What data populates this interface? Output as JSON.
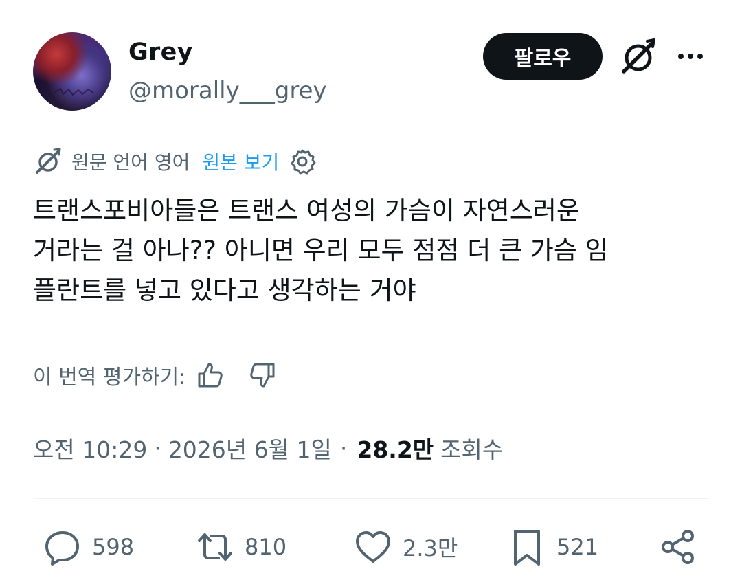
{
  "author": {
    "display_name": "Grey",
    "handle": "@morally___grey"
  },
  "header": {
    "follow_label": "팔로우"
  },
  "translation": {
    "source_label": "원문 언어 영어",
    "show_original_label": "원본 보기",
    "rate_label": "이 번역 평가하기:"
  },
  "tweet": {
    "text": "트랜스포비아들은 트랜스 여성의 가슴이 자연스러운\n거라는 걸 아나?? 아니면 우리 모두 점점 더 큰 가슴 임\n플란트를 넣고 있다고 생각하는 거야"
  },
  "meta": {
    "time": "오전 10:29",
    "separator": "·",
    "date": "2026년 6월 1일",
    "views_count": "28.2만",
    "views_label": "조회수"
  },
  "actions": {
    "replies": "598",
    "retweets": "810",
    "likes": "2.3만",
    "bookmarks": "521"
  },
  "colors": {
    "text_primary": "#0f1419",
    "text_secondary": "#536471",
    "link_blue": "#1d9bf0",
    "divider": "#eff3f4"
  },
  "icons": [
    "grok-icon",
    "more-icon",
    "translate-icon",
    "settings-icon",
    "thumbs-up-icon",
    "thumbs-down-icon",
    "reply-icon",
    "retweet-icon",
    "like-icon",
    "bookmark-icon",
    "share-icon"
  ]
}
